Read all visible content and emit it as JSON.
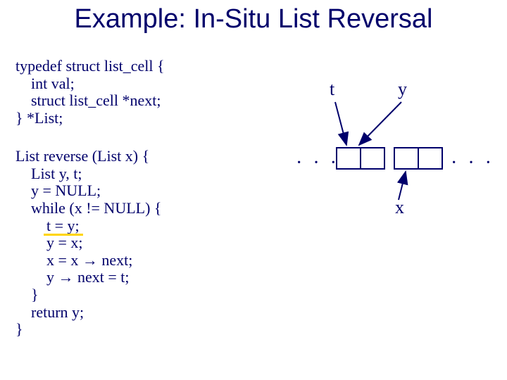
{
  "title": "Example: In-Situ List Reversal",
  "typedef": "typedef struct list_cell {\n    int val;\n    struct list_cell *next;\n} *List;",
  "reverse": "List reverse (List x) {\n    List y, t;\n    y = NULL;\n    while (x != NULL) {\n        t = y;\n        y = x;\n        x = x → next;\n        y → next = t;\n    }\n    return y;\n}",
  "labels": {
    "t": "t",
    "y": "y",
    "x": "x"
  },
  "dots": "· · ·"
}
